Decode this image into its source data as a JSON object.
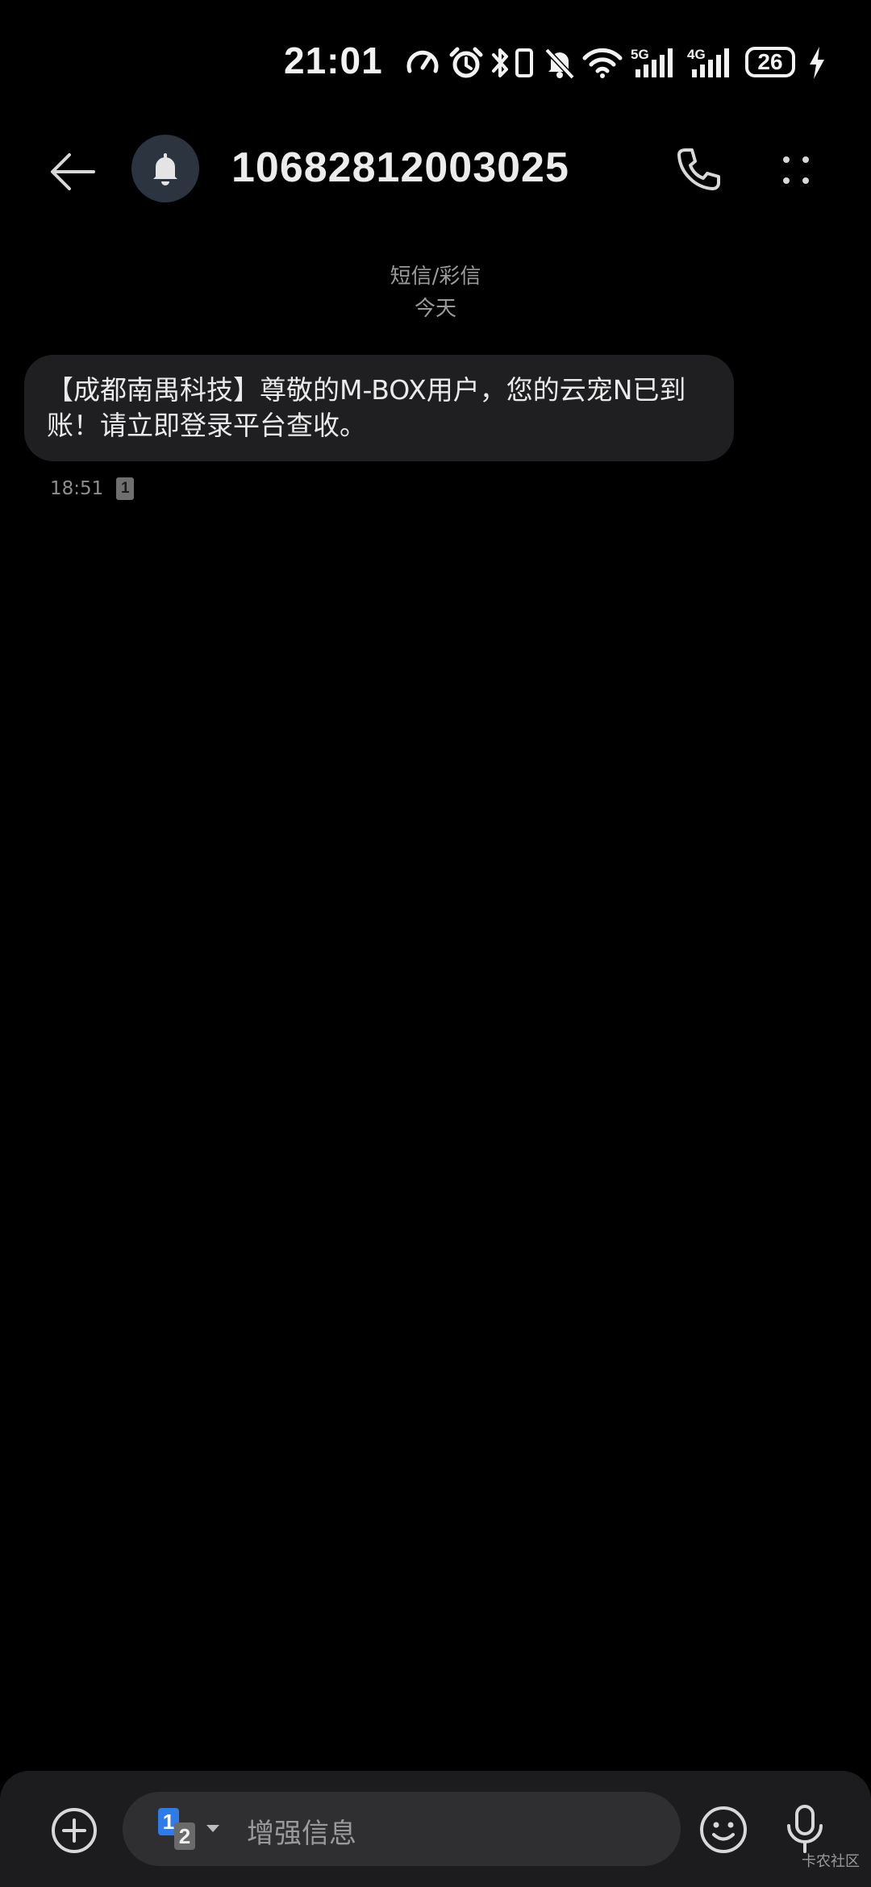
{
  "status_bar": {
    "time": "21:01",
    "network_5g": "5G",
    "network_4g": "4G",
    "battery_level": "26",
    "icons": [
      "speedometer-icon",
      "alarm-icon",
      "bluetooth-icon",
      "vibrate-icon",
      "mute-icon",
      "wifi-icon",
      "signal-icon",
      "signal-icon",
      "charging-icon"
    ]
  },
  "header": {
    "contact": "10682812003025",
    "icons": [
      "back-arrow-icon",
      "bell-icon",
      "phone-icon",
      "more-vertical-icon"
    ]
  },
  "conversation": {
    "message_type": "短信/彩信",
    "date": "今天",
    "messages": [
      {
        "text": "【成都南禺科技】尊敬的M-BOX用户，您的云宠N已到账！请立即登录平台查收。",
        "time": "18:51",
        "sim": "1"
      }
    ]
  },
  "composer": {
    "placeholder": "增强信息",
    "sim_primary": "1",
    "sim_secondary": "2",
    "icons": [
      "add-circle-icon",
      "caret-down-icon",
      "emoji-icon",
      "microphone-icon"
    ]
  },
  "watermark": "卡农社区",
  "colors": {
    "background": "#000000",
    "bubble": "#1f1f21",
    "composer": "#1c1c1e",
    "input": "#2f2f31",
    "avatar": "#2c3440",
    "sim_blue": "#2f7be8"
  }
}
